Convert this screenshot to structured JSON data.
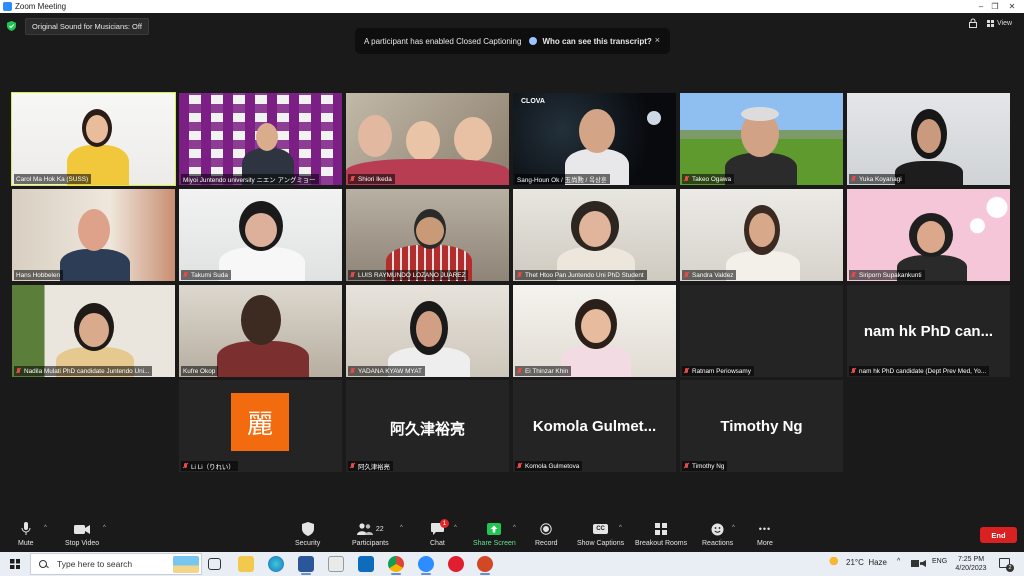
{
  "window": {
    "title": "Zoom Meeting",
    "controls": [
      "–",
      "❐",
      "✕"
    ]
  },
  "top": {
    "original_sound": "Original Sound for Musicians: Off",
    "banner_text": "A participant has enabled Closed Captioning",
    "banner_link": "Who can see this transcript?",
    "banner_close": "×",
    "view_label": "View"
  },
  "participants": [
    {
      "name": "Carol Ma Hok Ka (SUSS)",
      "muted": false,
      "video": true,
      "active": true
    },
    {
      "name": "Miyoi Juntendo university ニエン アングミョー",
      "muted": false,
      "video": true
    },
    {
      "name": "Shiori Ikeda",
      "muted": true,
      "video": true
    },
    {
      "name": "Sang-Houn Ok / 玉尚勲 / 옥상훈",
      "muted": false,
      "video": true,
      "overlay": "CLOVA"
    },
    {
      "name": "Takeo Ogawa",
      "muted": true,
      "video": true
    },
    {
      "name": "Yuka Koyanagi",
      "muted": true,
      "video": true
    },
    {
      "name": "Hans Hobbelen",
      "muted": false,
      "video": true
    },
    {
      "name": "Takumi Suda",
      "muted": true,
      "video": true
    },
    {
      "name": "LUIS RAYMUNDO LOZANO JUAREZ",
      "muted": true,
      "video": true
    },
    {
      "name": "Thet Htoo Pan Juntendo Uni PhD Student",
      "muted": true,
      "video": true
    },
    {
      "name": "Sandra Valdez",
      "muted": true,
      "video": true
    },
    {
      "name": "Siriporn Supakankunti",
      "muted": true,
      "video": true
    },
    {
      "name": "Nadila Mulati PhD candidate Juntendo Uni...",
      "muted": true,
      "video": true
    },
    {
      "name": "Kufre Okop",
      "muted": false,
      "video": true
    },
    {
      "name": "YADANA KYAW MYAT",
      "muted": true,
      "video": true
    },
    {
      "name": "Ei Thinzar Khin",
      "muted": true,
      "video": true
    },
    {
      "name": "Ratnam Periowsamy",
      "muted": true,
      "video": false,
      "display": ""
    },
    {
      "name": "nam hk PhD candidate (Dept Prev Med, Yo...",
      "muted": true,
      "video": false,
      "display": "nam hk PhD can..."
    },
    {
      "name": "Li Li（りれい）",
      "muted": true,
      "video": false,
      "avatar": "麗"
    },
    {
      "name": "阿久津裕亮",
      "muted": true,
      "video": false,
      "display": "阿久津裕亮"
    },
    {
      "name": "Komola Gulmetova",
      "muted": true,
      "video": false,
      "display": "Komola  Gulmet..."
    },
    {
      "name": "Timothy Ng",
      "muted": true,
      "video": false,
      "display": "Timothy Ng"
    }
  ],
  "toolbar": {
    "mute": "Mute",
    "stop_video": "Stop Video",
    "security": "Security",
    "participants": "Participants",
    "participants_count": "22",
    "chat": "Chat",
    "chat_badge": "1",
    "share_screen": "Share Screen",
    "record": "Record",
    "show_captions": "Show Captions",
    "breakout_rooms": "Breakout Rooms",
    "reactions": "Reactions",
    "more": "More",
    "end": "End",
    "cc_glyph": "CC",
    "more_glyph": "•••",
    "caret": "^"
  },
  "taskbar": {
    "search_placeholder": "Type here to search",
    "temperature": "21°C",
    "weather": "Haze",
    "language": "ENG",
    "time": "7:25 PM",
    "date": "4/20/2023",
    "notifications": "2",
    "tray_arrow": "^"
  },
  "colors": {
    "active_speaker": "#d7e94c",
    "share_green": "#23c552",
    "end_red": "#d92121",
    "muted_red": "#e84a4a"
  }
}
